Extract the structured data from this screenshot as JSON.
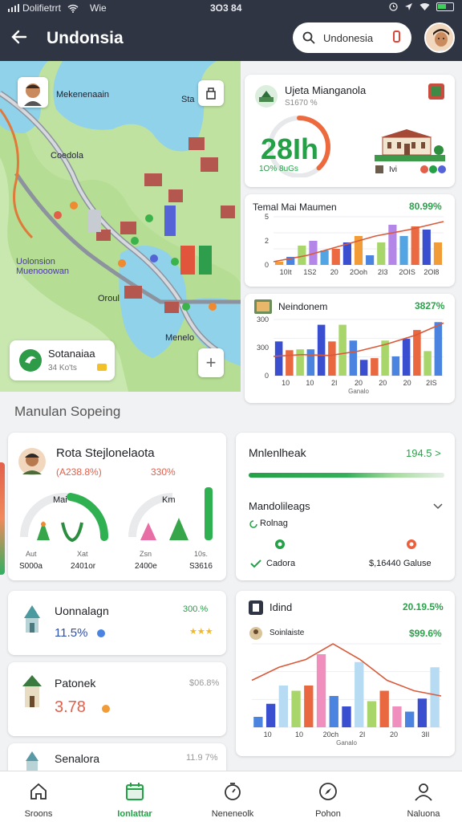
{
  "status_bar": {
    "carrier": "Dolifietrrt",
    "network": "Wie",
    "time": "3O3 84"
  },
  "app_bar": {
    "title": "Undonsia",
    "search_value": "Undonesia"
  },
  "map": {
    "labels": [
      "Mekenenaain",
      "Sta",
      "Coedola",
      "Uolonsion\nMuenooowan",
      "Oroul",
      "Menelo"
    ],
    "place_card": {
      "name": "Sotanaiaa",
      "meta": "34 Ko'ts"
    }
  },
  "stat_card": {
    "title": "Ujeta Mianganola",
    "subtitle": "S1670 %",
    "big_value": "28Ih",
    "caption": "1O% 8uGs",
    "legend_tag": "Ivi",
    "progress_pct": 0.38
  },
  "chart_card_1": {
    "title": "Temal Mai Maumen",
    "value": "80.99%"
  },
  "chart_card_2": {
    "title": "Neindonem",
    "value": "3827%"
  },
  "chart_card_3": {
    "title": "Idind",
    "value": "20.19.5%",
    "subtitle": "Soinlaiste",
    "subvalue": "$99.6%"
  },
  "section": {
    "title": "Manulan Sopeing"
  },
  "ring_card": {
    "title": "Rota Stejlonelaota",
    "left_pct": "(A238.8%)",
    "right_pct": "330%",
    "left_label": "Mai",
    "right_label": "Km",
    "stats": [
      {
        "label": "Aut",
        "value": "S000a"
      },
      {
        "label": "Xat",
        "value": "2401or"
      },
      {
        "label": "Zsn",
        "value": "2400e"
      },
      {
        "label": "10s.",
        "value": "S3616"
      }
    ]
  },
  "progress_card": {
    "title": "Mnlenlheak",
    "value": "194.5 >",
    "subtitle": "Mandolileags",
    "option": "Rolnag",
    "left_label": "Cadora",
    "right_label": "$,16440 Galuse"
  },
  "list_cards": [
    {
      "title": "Uonnalagn",
      "value": "11.5%",
      "aside": "300.%"
    },
    {
      "title": "Patonek",
      "value": "3.78",
      "aside": "$06.8%"
    },
    {
      "title": "Senalora",
      "value": "",
      "aside": "11.9 7%"
    }
  ],
  "chart_data": [
    {
      "type": "bar",
      "title": "Temal Mai Maumen",
      "categories": [
        "10It",
        "1S2",
        "20",
        "2Ooh",
        "2I3",
        "2OIS",
        "2Ol8"
      ],
      "series": [
        {
          "values": [
            2,
            5,
            12,
            15,
            9,
            10,
            14,
            18,
            6,
            14,
            25,
            18,
            24,
            22,
            14
          ]
        }
      ],
      "colors": [
        "#f29c38",
        "#4a84e0",
        "#a8d66a",
        "#b486e8",
        "#52a4e2",
        "#eb6a42",
        "#3a4ed0"
      ],
      "trend": [
        2,
        6,
        12,
        18,
        22,
        27
      ],
      "ylim": [
        0,
        30
      ],
      "yticks": [
        0,
        2,
        5
      ],
      "xlabel": "",
      "ylabel": ""
    },
    {
      "type": "bar",
      "title": "Neindonem",
      "categories": [
        "10",
        "10",
        "2I",
        "20",
        "20",
        "20",
        "2IS"
      ],
      "series": [
        {
          "values": [
            195,
            145,
            150,
            150,
            290,
            195,
            290,
            200,
            90,
            100,
            200,
            110,
            210,
            260,
            140,
            305
          ]
        }
      ],
      "colors": [
        "#3a4ed0",
        "#e9683f",
        "#a8d66a",
        "#4a84e0"
      ],
      "trend": [
        110,
        120,
        115,
        140,
        180,
        230,
        300
      ],
      "ylim": [
        0,
        320
      ],
      "yticks": [
        0,
        300,
        300
      ],
      "xlabel": "Ganalo",
      "ylabel": ""
    },
    {
      "type": "bar",
      "title": "Idind",
      "categories": [
        "10",
        "10",
        "20ch",
        "2I",
        "20",
        "3II"
      ],
      "series": [
        {
          "values": [
            20,
            45,
            80,
            70,
            80,
            140,
            60,
            40,
            125,
            50,
            70,
            40,
            30,
            55,
            115
          ]
        }
      ],
      "colors": [
        "#4a84e0",
        "#3a4ed0",
        "#b6dbf2",
        "#a8d66a",
        "#e9683f",
        "#f08fbe"
      ],
      "trend": [
        90,
        115,
        130,
        160,
        130,
        90,
        70,
        60
      ],
      "ylim": [
        0,
        160
      ],
      "xlabel": "Ganalo",
      "ylabel": ""
    }
  ],
  "nav": {
    "items": [
      {
        "label": "Sroons",
        "icon": "home-icon"
      },
      {
        "label": "Ionlattar",
        "icon": "calendar-icon",
        "active": true
      },
      {
        "label": "Neneneolk",
        "icon": "timer-icon"
      },
      {
        "label": "Pohon",
        "icon": "compass-icon"
      },
      {
        "label": "Naluona",
        "icon": "profile-icon"
      }
    ]
  }
}
